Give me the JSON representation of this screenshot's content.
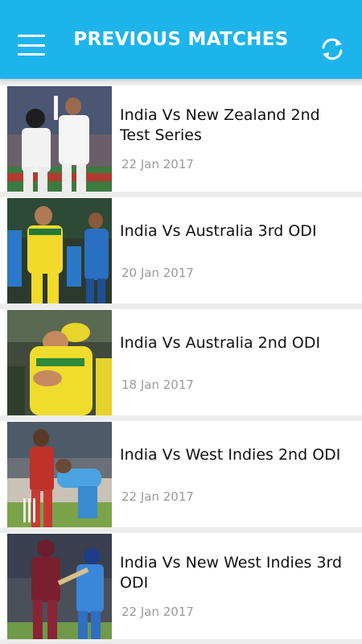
{
  "header": {
    "title": "PREVIOUS MATCHES",
    "menu_icon": "hamburger-menu-icon",
    "refresh_icon": "refresh-icon",
    "background_color": "#1db4ec"
  },
  "matches": [
    {
      "title": "India Vs New Zealand 2nd Test Series",
      "date": "22 Jan 2017"
    },
    {
      "title": "India Vs Australia 3rd ODI",
      "date": "20 Jan 2017"
    },
    {
      "title": "India Vs Australia 2nd ODI",
      "date": "18 Jan 2017"
    },
    {
      "title": "India Vs West Indies 2nd ODI",
      "date": "22 Jan 2017"
    },
    {
      "title": "India Vs New West Indies 3rd ODI",
      "date": "22 Jan 2017"
    }
  ]
}
